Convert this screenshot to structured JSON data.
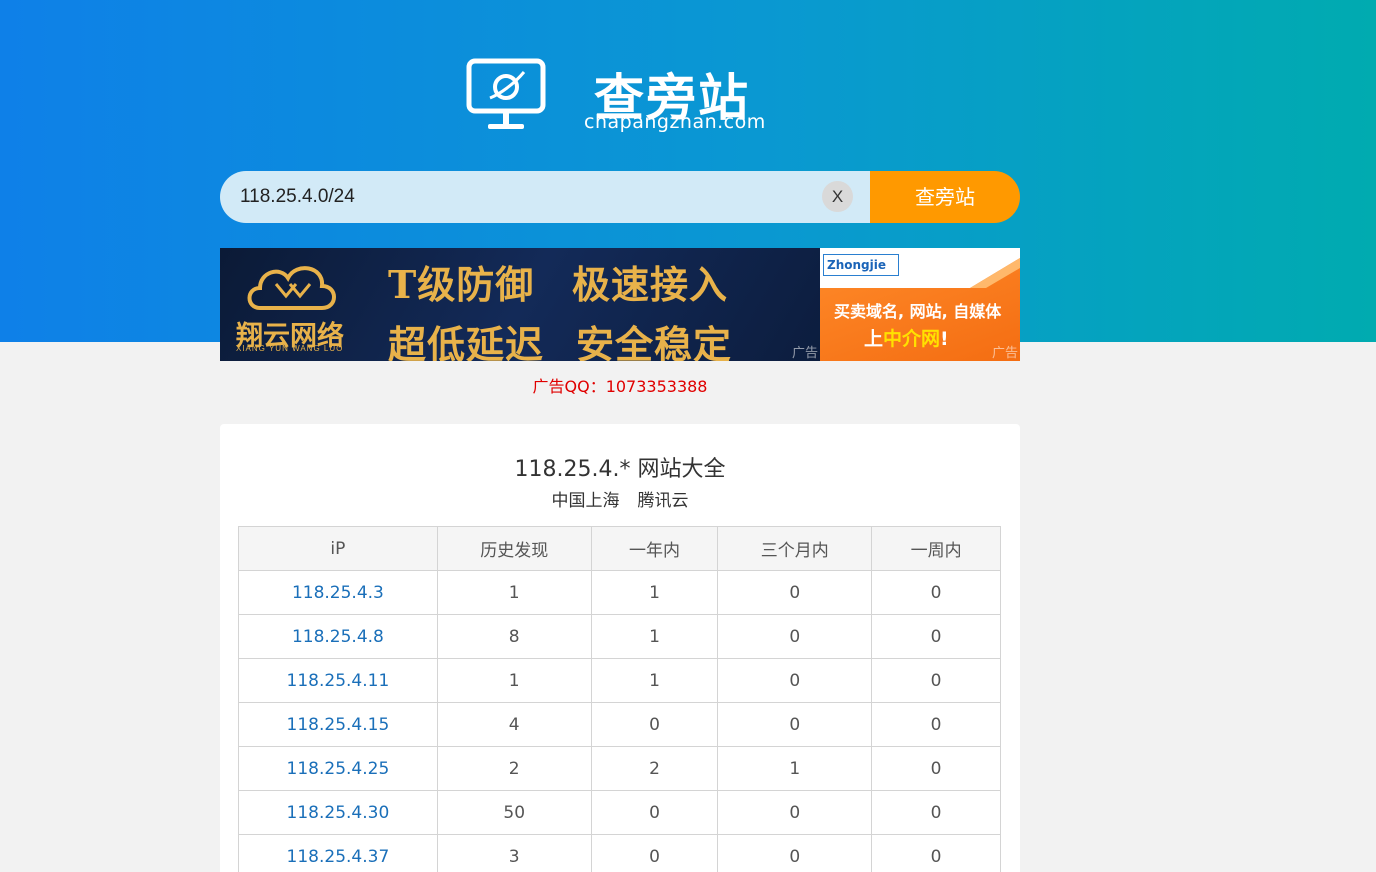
{
  "brand": {
    "name_cn": "查旁站",
    "domain": "chapangzhan.com"
  },
  "search": {
    "value": "118.25.4.0/24",
    "clear_label": "X",
    "button_label": "查旁站"
  },
  "ads": {
    "banner1": {
      "brand": "翔云网络",
      "brand_sub": "XIANG YUN WANG LUO",
      "line1a": "T级防御",
      "line1b": "极速接入",
      "line2a": "超低延迟",
      "line2b": "安全稳定",
      "tag": "广告"
    },
    "banner2": {
      "logo": "Zhongjie",
      "line1": "买卖域名, 网站, 自媒体",
      "line2_pre": "上",
      "line2_hl": "中介网",
      "line2_post": "!",
      "tag": "广告"
    },
    "qq": "广告QQ：1073353388"
  },
  "result": {
    "title": "118.25.4.* 网站大全",
    "location": "中国上海",
    "provider": "腾讯云",
    "columns": [
      "iP",
      "历史发现",
      "一年内",
      "三个月内",
      "一周内"
    ],
    "rows": [
      {
        "ip": "118.25.4.3",
        "history": "1",
        "year": "1",
        "three_months": "0",
        "week": "0"
      },
      {
        "ip": "118.25.4.8",
        "history": "8",
        "year": "1",
        "three_months": "0",
        "week": "0"
      },
      {
        "ip": "118.25.4.11",
        "history": "1",
        "year": "1",
        "three_months": "0",
        "week": "0"
      },
      {
        "ip": "118.25.4.15",
        "history": "4",
        "year": "0",
        "three_months": "0",
        "week": "0"
      },
      {
        "ip": "118.25.4.25",
        "history": "2",
        "year": "2",
        "three_months": "1",
        "week": "0"
      },
      {
        "ip": "118.25.4.30",
        "history": "50",
        "year": "0",
        "three_months": "0",
        "week": "0"
      },
      {
        "ip": "118.25.4.37",
        "history": "3",
        "year": "0",
        "three_months": "0",
        "week": "0"
      }
    ]
  },
  "colors": {
    "hero_start": "#0e80e8",
    "hero_end": "#00abb0",
    "search_button": "#ff9900",
    "link": "#1a6fb9",
    "ad_qq": "#e00000"
  }
}
